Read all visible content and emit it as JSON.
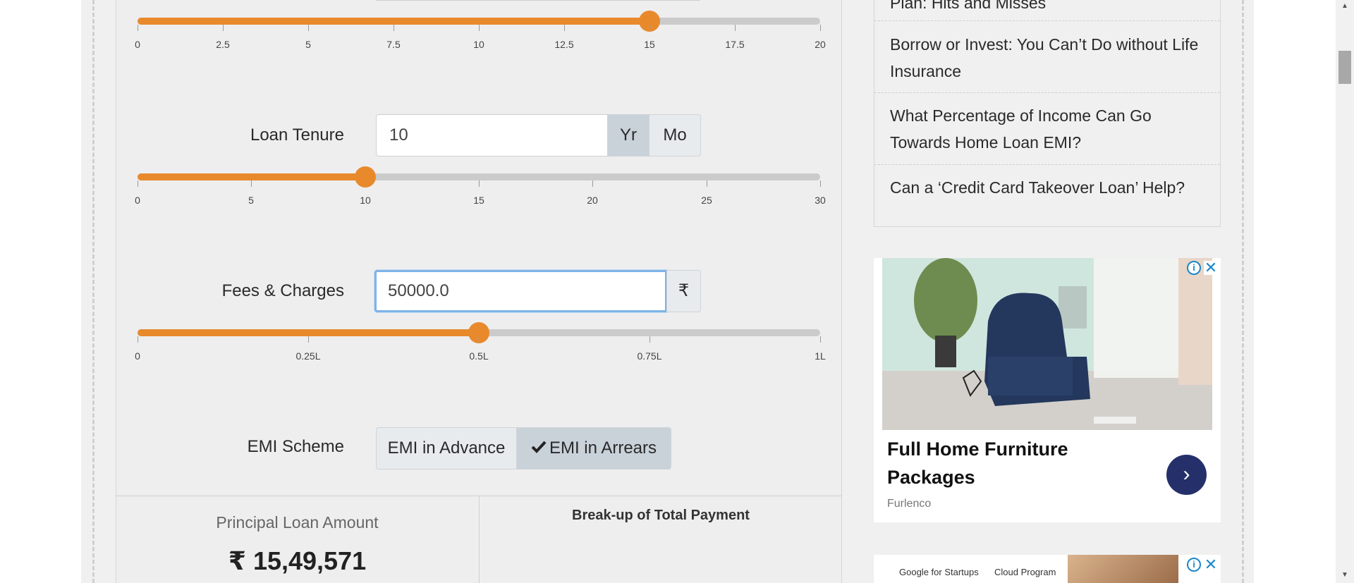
{
  "calculator": {
    "interest_slider": {
      "ticks": [
        "0",
        "2.5",
        "5",
        "7.5",
        "10",
        "12.5",
        "15",
        "17.5",
        "20"
      ],
      "min": 0,
      "max": 20,
      "value": 15
    },
    "loan_tenure": {
      "label": "Loan Tenure",
      "value": "10",
      "unit_year": "Yr",
      "unit_month": "Mo",
      "active_unit": "Yr",
      "slider": {
        "ticks": [
          "0",
          "5",
          "10",
          "15",
          "20",
          "25",
          "30"
        ],
        "min": 0,
        "max": 30,
        "value": 10
      }
    },
    "fees_charges": {
      "label": "Fees & Charges",
      "value": "50000.0",
      "currency": "₹",
      "slider": {
        "ticks": [
          "0",
          "0.25L",
          "0.5L",
          "0.75L",
          "1L"
        ],
        "min": 0,
        "max": 1,
        "value": 0.5
      }
    },
    "emi_scheme": {
      "label": "EMI Scheme",
      "option_advance": "EMI in Advance",
      "option_arrears": "EMI in Arrears",
      "selected": "EMI in Arrears"
    },
    "results": {
      "principal_label": "Principal Loan Amount",
      "principal_value": "₹ 15,49,571",
      "breakup_title": "Break-up of Total Payment"
    }
  },
  "sidebar": {
    "partial_item": "Plan: Hits and Misses",
    "items": [
      "Borrow or Invest: You Can’t Do without Life Insurance",
      "What Percentage of Income Can Go Towards Home Loan EMI?",
      "Can a ‘Credit Card Takeover Loan’ Help?"
    ]
  },
  "ads": {
    "ad1": {
      "headline": "Full Home Furniture Packages",
      "brand": "Furlenco",
      "info_icon": "i",
      "close_icon": "✕",
      "arrow_icon": "›"
    },
    "ad2": {
      "google_text": "Google for Startups",
      "cloud_text": "Cloud Program",
      "info_icon": "i",
      "close_icon": "✕"
    }
  },
  "colors": {
    "accent": "#e88a2c",
    "track": "#cbcbcb",
    "ad_button": "#25306b",
    "ad_info": "#1a88c9"
  }
}
